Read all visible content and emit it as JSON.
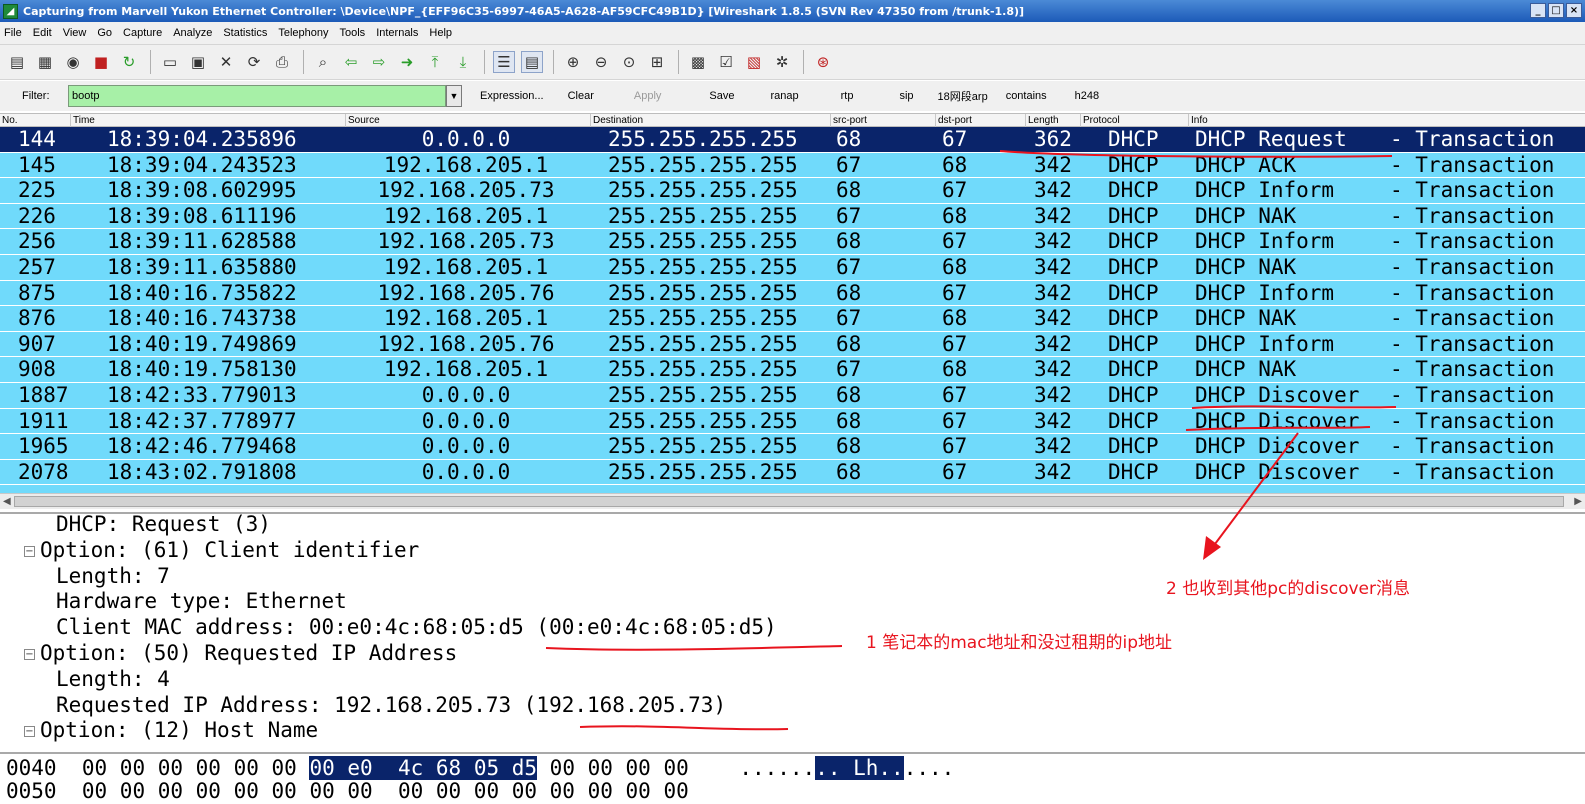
{
  "window": {
    "title": "Capturing from Marvell Yukon Ethernet Controller: \\Device\\NPF_{EFF96C35-6997-46A5-A628-AF59CFC49B1D}   [Wireshark 1.8.5  (SVN Rev 47350 from /trunk-1.8)]"
  },
  "menu": [
    "File",
    "Edit",
    "View",
    "Go",
    "Capture",
    "Analyze",
    "Statistics",
    "Telephony",
    "Tools",
    "Internals",
    "Help"
  ],
  "filter": {
    "label": "Filter:",
    "value": "bootp",
    "expression": "Expression...",
    "clear": "Clear",
    "apply": "Apply",
    "save": "Save",
    "buttons": [
      "ranap",
      "rtp",
      "sip",
      "18网段arp",
      "contains",
      "h248"
    ]
  },
  "columns": [
    "No.",
    "Time",
    "Source",
    "Destination",
    "src-port",
    "dst-port",
    "Length",
    "Protocol",
    "Info"
  ],
  "packets": [
    {
      "no": "144",
      "time": "18:39:04.235896",
      "src": "0.0.0.0",
      "dst": "255.255.255.255",
      "sp": "68",
      "dp": "67",
      "len": "362",
      "proto": "DHCP",
      "info": "DHCP Request",
      "tx": "- Transaction"
    },
    {
      "no": "145",
      "time": "18:39:04.243523",
      "src": "192.168.205.1",
      "dst": "255.255.255.255",
      "sp": "67",
      "dp": "68",
      "len": "342",
      "proto": "DHCP",
      "info": "DHCP ACK",
      "tx": "- Transaction"
    },
    {
      "no": "225",
      "time": "18:39:08.602995",
      "src": "192.168.205.73",
      "dst": "255.255.255.255",
      "sp": "68",
      "dp": "67",
      "len": "342",
      "proto": "DHCP",
      "info": "DHCP Inform",
      "tx": "- Transaction"
    },
    {
      "no": "226",
      "time": "18:39:08.611196",
      "src": "192.168.205.1",
      "dst": "255.255.255.255",
      "sp": "67",
      "dp": "68",
      "len": "342",
      "proto": "DHCP",
      "info": "DHCP NAK",
      "tx": "- Transaction"
    },
    {
      "no": "256",
      "time": "18:39:11.628588",
      "src": "192.168.205.73",
      "dst": "255.255.255.255",
      "sp": "68",
      "dp": "67",
      "len": "342",
      "proto": "DHCP",
      "info": "DHCP Inform",
      "tx": "- Transaction"
    },
    {
      "no": "257",
      "time": "18:39:11.635880",
      "src": "192.168.205.1",
      "dst": "255.255.255.255",
      "sp": "67",
      "dp": "68",
      "len": "342",
      "proto": "DHCP",
      "info": "DHCP NAK",
      "tx": "- Transaction"
    },
    {
      "no": "875",
      "time": "18:40:16.735822",
      "src": "192.168.205.76",
      "dst": "255.255.255.255",
      "sp": "68",
      "dp": "67",
      "len": "342",
      "proto": "DHCP",
      "info": "DHCP Inform",
      "tx": "- Transaction"
    },
    {
      "no": "876",
      "time": "18:40:16.743738",
      "src": "192.168.205.1",
      "dst": "255.255.255.255",
      "sp": "67",
      "dp": "68",
      "len": "342",
      "proto": "DHCP",
      "info": "DHCP NAK",
      "tx": "- Transaction"
    },
    {
      "no": "907",
      "time": "18:40:19.749869",
      "src": "192.168.205.76",
      "dst": "255.255.255.255",
      "sp": "68",
      "dp": "67",
      "len": "342",
      "proto": "DHCP",
      "info": "DHCP Inform",
      "tx": "- Transaction"
    },
    {
      "no": "908",
      "time": "18:40:19.758130",
      "src": "192.168.205.1",
      "dst": "255.255.255.255",
      "sp": "67",
      "dp": "68",
      "len": "342",
      "proto": "DHCP",
      "info": "DHCP NAK",
      "tx": "- Transaction"
    },
    {
      "no": "1887",
      "time": "18:42:33.779013",
      "src": "0.0.0.0",
      "dst": "255.255.255.255",
      "sp": "68",
      "dp": "67",
      "len": "342",
      "proto": "DHCP",
      "info": "DHCP Discover",
      "tx": "- Transaction"
    },
    {
      "no": "1911",
      "time": "18:42:37.778977",
      "src": "0.0.0.0",
      "dst": "255.255.255.255",
      "sp": "68",
      "dp": "67",
      "len": "342",
      "proto": "DHCP",
      "info": "DHCP Discover",
      "tx": "- Transaction"
    },
    {
      "no": "1965",
      "time": "18:42:46.779468",
      "src": "0.0.0.0",
      "dst": "255.255.255.255",
      "sp": "68",
      "dp": "67",
      "len": "342",
      "proto": "DHCP",
      "info": "DHCP Discover",
      "tx": "- Transaction"
    },
    {
      "no": "2078",
      "time": "18:43:02.791808",
      "src": "0.0.0.0",
      "dst": "255.255.255.255",
      "sp": "68",
      "dp": "67",
      "len": "342",
      "proto": "DHCP",
      "info": "DHCP Discover",
      "tx": "- Transaction"
    }
  ],
  "selected_row": 0,
  "details": [
    {
      "text": "DHCP: Request (3)",
      "indent": 1,
      "expander": false
    },
    {
      "text": "Option: (61) Client identifier",
      "indent": 0,
      "expander": true
    },
    {
      "text": "Length: 7",
      "indent": 1,
      "expander": false
    },
    {
      "text": "Hardware type: Ethernet",
      "indent": 1,
      "expander": false
    },
    {
      "text": "Client MAC address: 00:e0:4c:68:05:d5 (00:e0:4c:68:05:d5)",
      "indent": 1,
      "expander": false
    },
    {
      "text": "Option: (50) Requested IP Address",
      "indent": 0,
      "expander": true
    },
    {
      "text": "Length: 4",
      "indent": 1,
      "expander": false
    },
    {
      "text": "Requested IP Address: 192.168.205.73 (192.168.205.73)",
      "indent": 1,
      "expander": false
    },
    {
      "text": "Option: (12) Host Name",
      "indent": 0,
      "expander": true
    }
  ],
  "bytes": {
    "offset": "0040",
    "pre": "00 00 00 00 00 00 ",
    "hl": "00 e0  4c 68 05 d5",
    "post": " 00 00 00 00",
    "ascii_pre": "......",
    "ascii_hl": ".. Lh..",
    "ascii_post": "....",
    "offset2": "0050",
    "row2": "00 00 00 00 00 00 00 00  00 00 00 00 00 00 00 00"
  },
  "annotations": {
    "note1": "1 笔记本的mac地址和没过租期的ip地址",
    "note2": "2 也收到其他pc的discover消息",
    "color": "#e8141e"
  },
  "colors": {
    "row_bg": "#70dafb",
    "selected_bg": "#0a246a",
    "filter_bg": "#a7f0a7"
  }
}
